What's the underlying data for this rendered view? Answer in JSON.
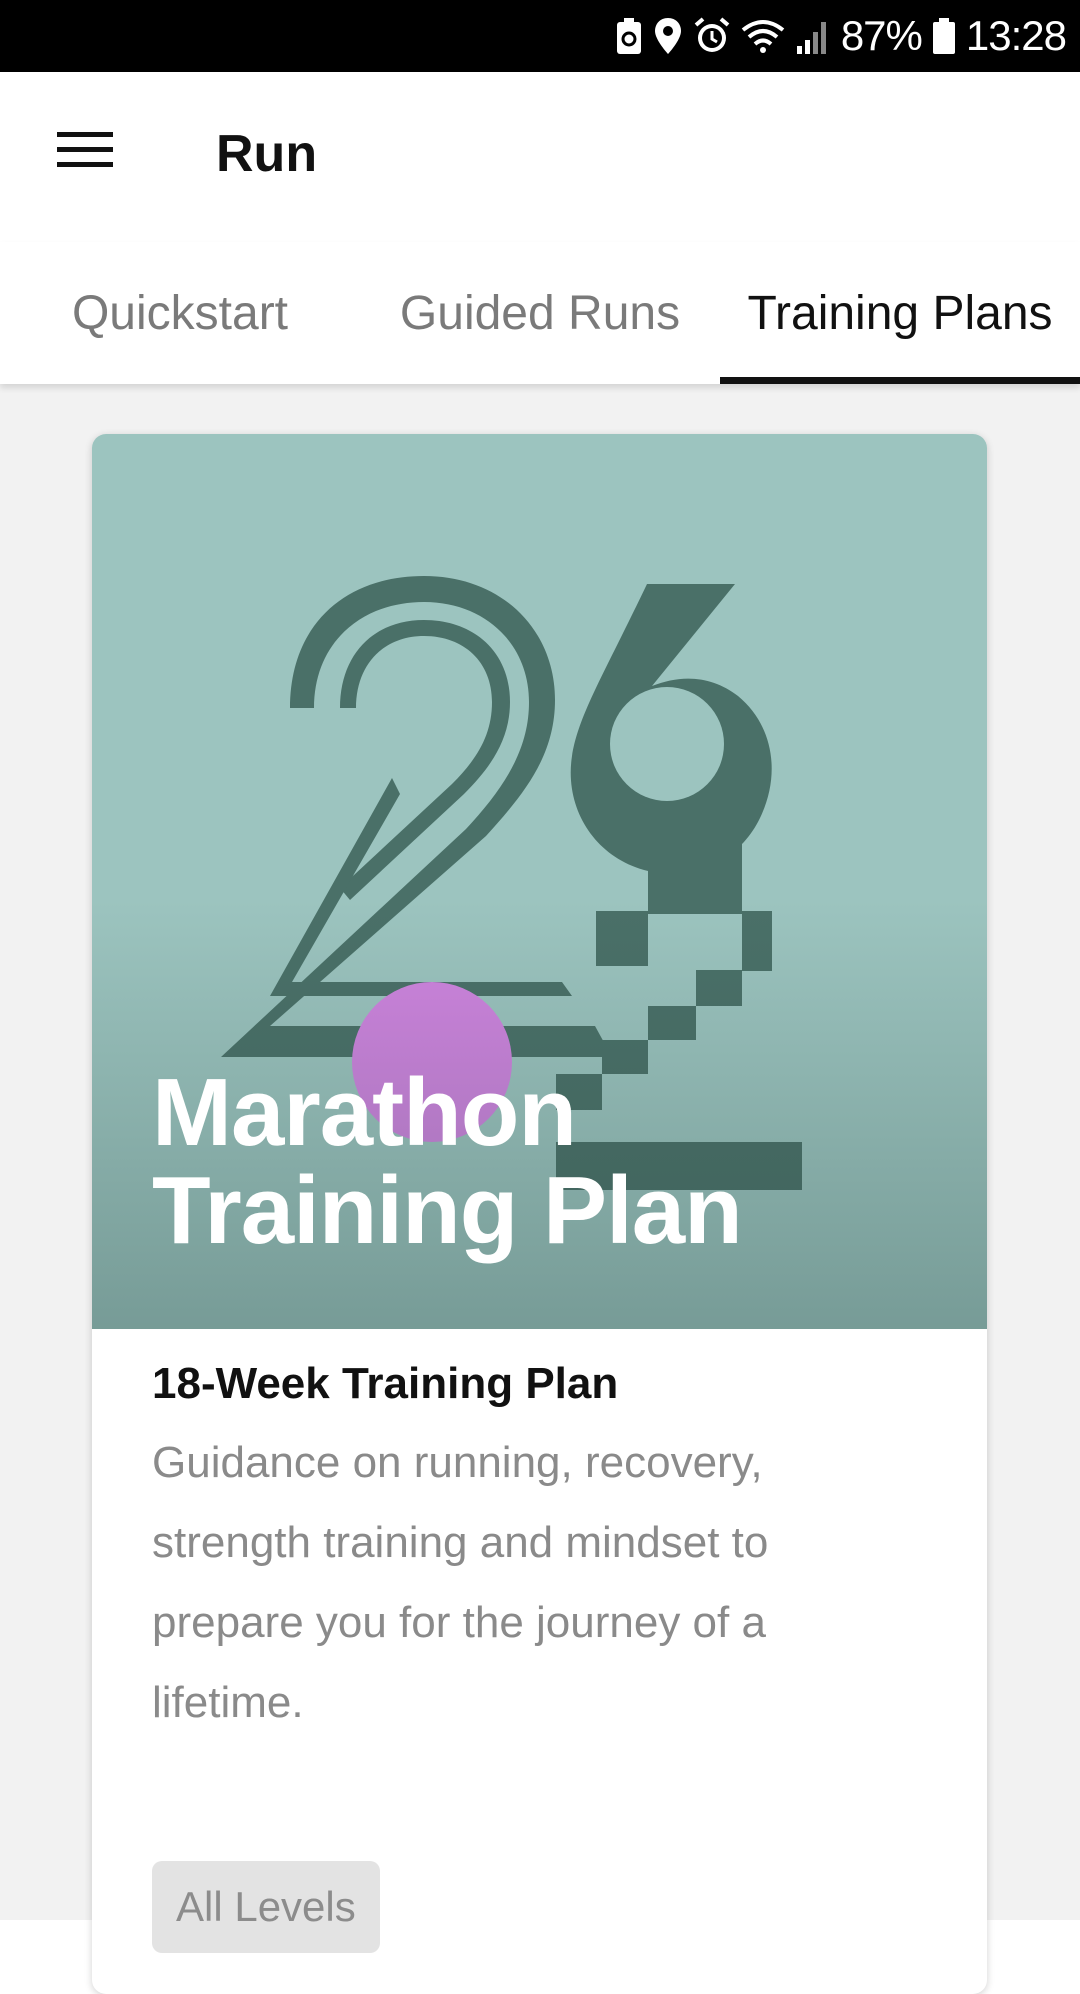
{
  "status_bar": {
    "battery_text": "87%",
    "time": "13:28",
    "icons": [
      "recycle-battery-icon",
      "location-icon",
      "alarm-icon",
      "wifi-icon",
      "signal-icon",
      "battery-icon"
    ]
  },
  "app_bar": {
    "menu_icon": "hamburger-menu-icon",
    "title": "Run"
  },
  "tabs": [
    {
      "label": "Quickstart",
      "active": false
    },
    {
      "label": "Guided Runs",
      "active": false
    },
    {
      "label": "Training Plans",
      "active": true
    }
  ],
  "card": {
    "hero_title_line1": "Marathon",
    "hero_title_line2": "Training Plan",
    "plan_title": "18-Week Training Plan",
    "description": "Guidance on running, recovery, strength training and mindset to prepare you for the journey of a lifetime.",
    "level": "All Levels"
  },
  "colors": {
    "hero_background": "#9cc4bf",
    "hero_art": "#4a7068",
    "accent_dot": "#d084e0",
    "active_tab": "#111111",
    "inactive_tab": "#7a7a7a"
  }
}
